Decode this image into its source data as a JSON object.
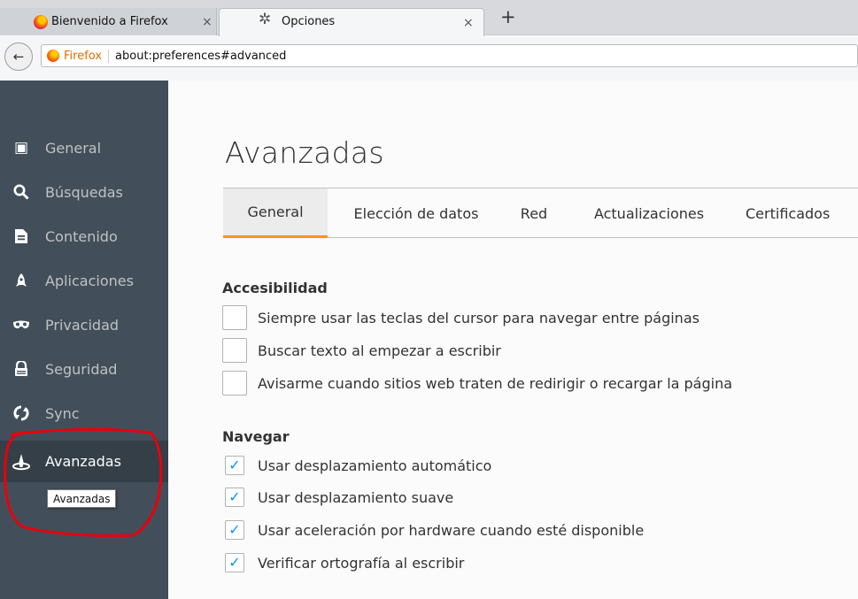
{
  "browser": {
    "tabs": [
      {
        "title": "Bienvenido a Firefox",
        "close": "×"
      },
      {
        "title": "Opciones",
        "close": "×"
      }
    ],
    "new_tab_label": "+",
    "back_label": "←",
    "url_identity": "Firefox",
    "url": "about:preferences#advanced"
  },
  "sidebar": {
    "items": [
      {
        "label": "General",
        "icon": "general-icon",
        "glyph": "▣"
      },
      {
        "label": "Búsquedas",
        "icon": "search-icon",
        "glyph": "🔍︎"
      },
      {
        "label": "Contenido",
        "icon": "document-icon",
        "glyph": "▤"
      },
      {
        "label": "Aplicaciones",
        "icon": "rocket-icon",
        "glyph": "⯅"
      },
      {
        "label": "Privacidad",
        "icon": "mask-icon",
        "glyph": "∞"
      },
      {
        "label": "Seguridad",
        "icon": "lock-icon",
        "glyph": "⩍"
      },
      {
        "label": "Sync",
        "icon": "sync-icon",
        "glyph": "⟳"
      },
      {
        "label": "Avanzadas",
        "icon": "wizard-hat-icon",
        "glyph": "⛬"
      }
    ],
    "selected": "Avanzadas",
    "tooltip": "Avanzadas",
    "highlight_color": "#e8000b"
  },
  "main": {
    "title": "Avanzadas",
    "tabs": [
      "General",
      "Elección de datos",
      "Red",
      "Actualizaciones",
      "Certificados"
    ],
    "active_tab": "General",
    "groups": [
      {
        "title": "Accesibilidad",
        "options": [
          {
            "label": "Siempre usar las teclas del cursor para navegar entre páginas",
            "checked": false
          },
          {
            "label": "Buscar texto al empezar a escribir",
            "checked": false
          },
          {
            "label": "Avisarme cuando sitios web traten de redirigir o recargar la página",
            "checked": false
          }
        ]
      },
      {
        "title": "Navegar",
        "options": [
          {
            "label": "Usar desplazamiento automático",
            "checked": true
          },
          {
            "label": "Usar desplazamiento suave",
            "checked": true
          },
          {
            "label": "Usar aceleración por hardware cuando esté disponible",
            "checked": true
          },
          {
            "label": "Verificar ortografía al escribir",
            "checked": true
          }
        ]
      }
    ],
    "check_glyph": "✓"
  },
  "colors": {
    "sidebar_bg": "#424f5a",
    "sidebar_selected_bg": "#343f48",
    "tab_accent": "#ff9500",
    "checkmark": "#0996f8"
  }
}
